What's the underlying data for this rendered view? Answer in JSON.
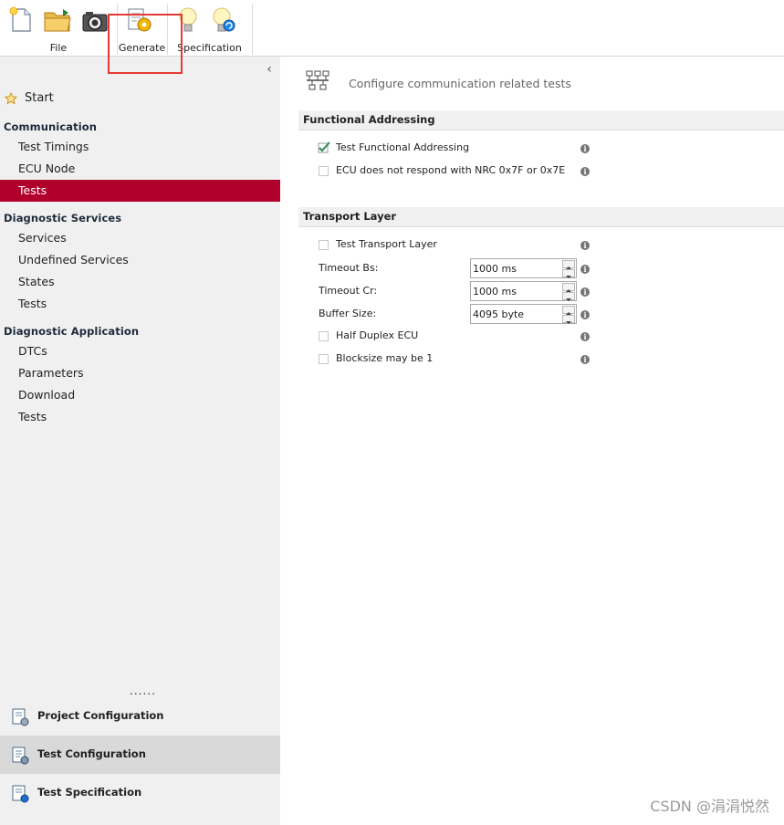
{
  "toolbar": {
    "groups": [
      {
        "label": "File"
      },
      {
        "label": "Generate"
      },
      {
        "label": "Specification"
      }
    ],
    "icons": [
      "new-document-icon",
      "open-folder-icon",
      "camera-icon",
      "generate-gear-icon",
      "lightbulb-icon",
      "lightbulb-refresh-icon"
    ]
  },
  "sidebar": {
    "collapse_glyph": "‹",
    "start_label": "Start",
    "sections": [
      {
        "title": "Communication",
        "items": [
          "Test Timings",
          "ECU Node",
          "Tests"
        ]
      },
      {
        "title": "Diagnostic  Services",
        "items": [
          "Services",
          "Undefined Services",
          "States",
          "Tests"
        ]
      },
      {
        "title": "Diagnostic  Application",
        "items": [
          "DTCs",
          "Parameters",
          "Download",
          "Tests"
        ]
      }
    ],
    "active_item": "Communication/Tests",
    "dots": "......",
    "bottom_items": [
      "Project Configuration",
      "Test Configuration",
      "Test Specification"
    ],
    "active_bottom": "Test Configuration"
  },
  "main": {
    "header": "Configure communication related tests",
    "functional_addressing": {
      "title": "Functional Addressing",
      "options": [
        {
          "label": "Test Functional Addressing",
          "checked": true
        },
        {
          "label": "ECU does not respond with NRC 0x7F or 0x7E",
          "checked": false
        }
      ]
    },
    "transport_layer": {
      "title": "Transport Layer",
      "test_transport_layer": {
        "label": "Test Transport Layer",
        "checked": false
      },
      "fields": [
        {
          "label": "Timeout Bs:",
          "value": "1000 ms"
        },
        {
          "label": "Timeout Cr:",
          "value": "1000 ms"
        },
        {
          "label": "Buffer Size:",
          "value": "4095 byte"
        }
      ],
      "half_duplex": {
        "label": "Half Duplex ECU",
        "checked": false
      },
      "blocksize": {
        "label": "Blocksize may be 1",
        "checked": false
      }
    },
    "info_glyph": "i"
  },
  "colors": {
    "active_nav_bg": "#b1002c",
    "highlight_box": "#e53935",
    "sidebar_bg": "#f0f0f0"
  },
  "watermark": "CSDN @涓涓悦然"
}
